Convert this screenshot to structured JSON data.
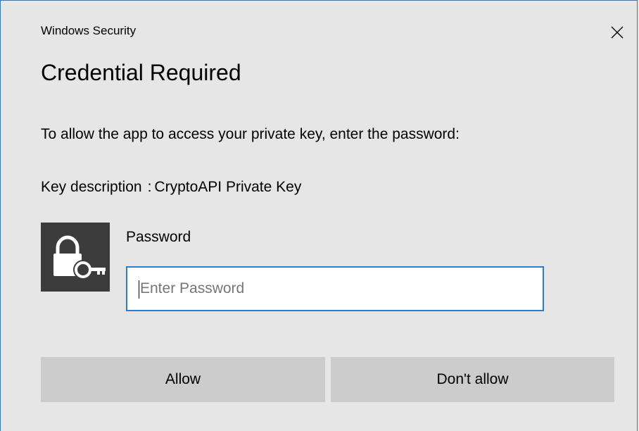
{
  "window": {
    "caption": "Windows Security",
    "title": "Credential Required",
    "close_icon": "close-icon"
  },
  "prompt": {
    "message": "To allow the app to access your private key, enter the password:",
    "key_description_label": "Key description",
    "key_description_separator": ":",
    "key_description_value": "CryptoAPI Private Key"
  },
  "credential": {
    "icon": "lock-key-icon",
    "password_label": "Password",
    "password_value": "",
    "password_placeholder": "Enter Password"
  },
  "buttons": {
    "allow": "Allow",
    "deny": "Don't allow"
  },
  "colors": {
    "background": "#e6e6e6",
    "accent_border": "#2a7ed0",
    "button": "#cccccc",
    "tile": "#3c3c3c"
  }
}
